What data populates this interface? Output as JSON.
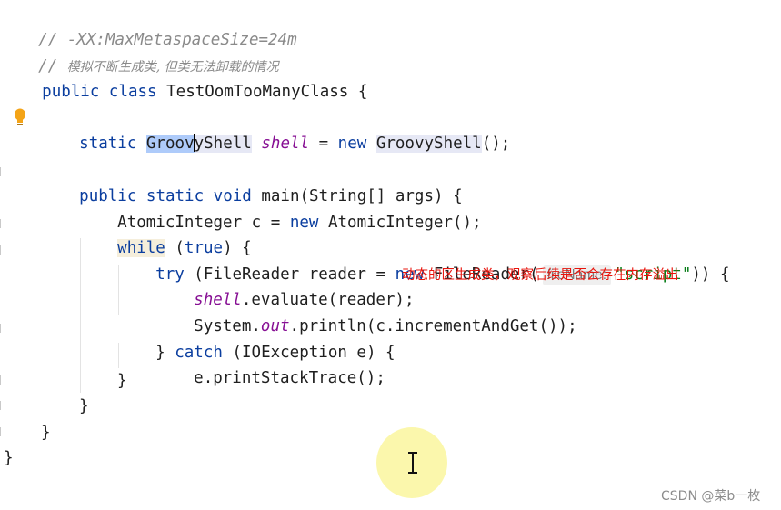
{
  "code": {
    "comment1": "// -XX:MaxMetaspaceSize=24m",
    "comment2_prefix": "// ",
    "comment2_text": "模拟不断生成类, 但类无法卸载的情况",
    "class_kw": "public class",
    "class_name": " TestOomTooManyClass {",
    "field_static": "static",
    "field_type_sel": "Groov",
    "field_type_rest": "yShell",
    "field_name": "shell",
    "field_assign": " = ",
    "field_new": "new",
    "field_ctor": "GroovyShell",
    "field_end": "();",
    "main_kw": "public static void",
    "main_sig": " main(String[] args) {",
    "atomic_decl": "AtomicInteger c = ",
    "atomic_new": "new",
    "atomic_ctor": " AtomicInteger();",
    "while_kw": "while",
    "while_open": " (",
    "true_kw": "true",
    "while_close": ") {",
    "try_kw": "try",
    "try_decl": " (FileReader reader = ",
    "try_new": "new",
    "try_ctor": " FileReader(",
    "param_hint": "fileName:",
    "script_str": "\"script\"",
    "try_end": ")) {",
    "eval_field": "shell",
    "eval_rest": ".evaluate(reader);",
    "sys_prefix": "System.",
    "sys_out": "out",
    "sys_rest": ".println(c.incrementAndGet());",
    "catch_open": "} ",
    "catch_kw": "catch",
    "catch_rest": " (IOException e) {",
    "print_trace": "e.printStackTrace();",
    "brace": "}"
  },
  "annotation": "动态的区生成类，观察后续是否会存在内存溢出",
  "watermark": "CSDN @菜b一枚",
  "icons": [
    "lightbulb-icon",
    "text-cursor-icon"
  ],
  "colors": {
    "keyword": "#0b3e9f",
    "field": "#871094",
    "string": "#067d17",
    "comment": "#8a8a8a",
    "annotation": "#e8140c",
    "selection": "#aecbfa"
  }
}
